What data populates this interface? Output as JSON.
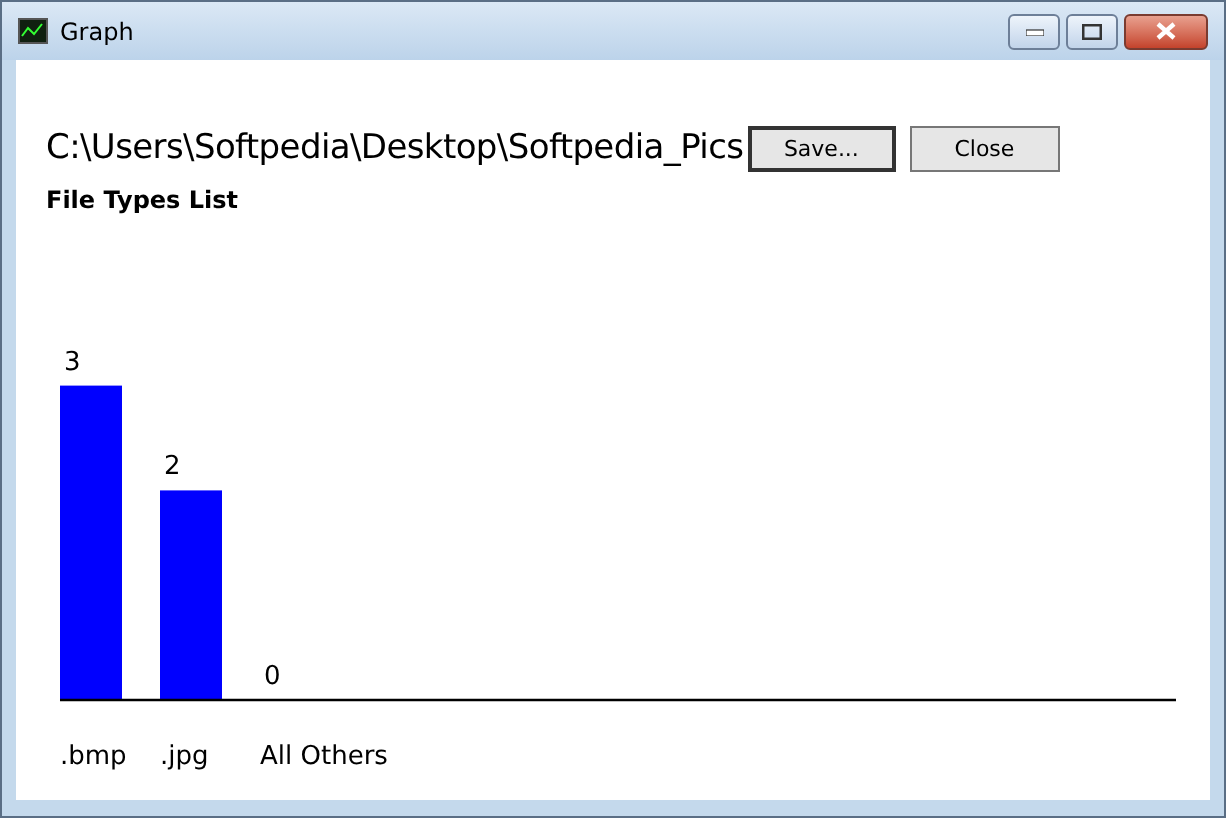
{
  "window": {
    "title": "Graph"
  },
  "path": "C:\\Users\\Softpedia\\Desktop\\Softpedia_Pics",
  "buttons": [
    {
      "label": "Save...",
      "selected": true
    },
    {
      "label": "Close",
      "selected": false
    }
  ],
  "chart_title": "File Types List",
  "chart_data": {
    "type": "bar",
    "categories": [
      ".bmp",
      ".jpg",
      "All Others"
    ],
    "values": [
      3,
      2,
      0
    ],
    "data_labels": true
  }
}
